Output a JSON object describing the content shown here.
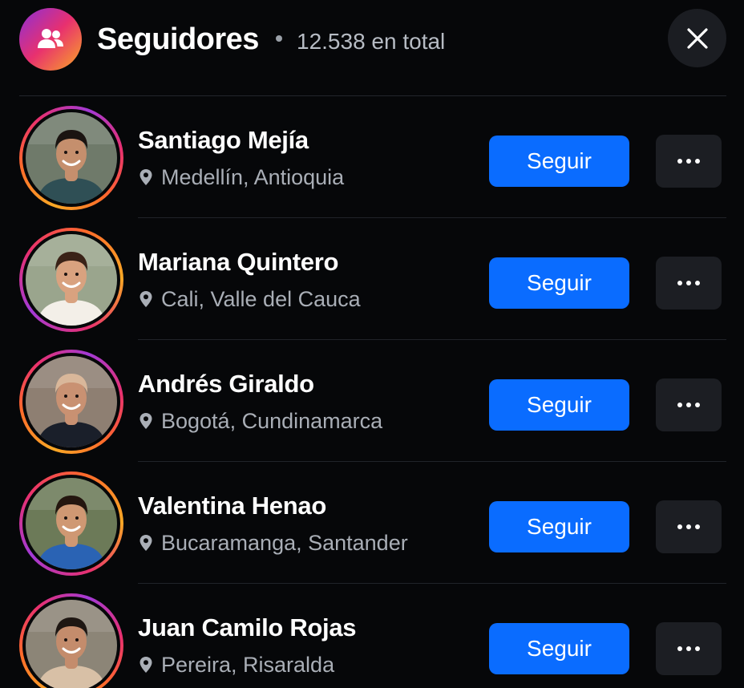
{
  "header": {
    "title": "Seguidores",
    "count_text": "12.538 en total",
    "icon": "users-icon",
    "close_icon": "close-icon"
  },
  "followers": [
    {
      "name": "Santiago Mejía",
      "location": "Medellín, Antioquia",
      "button": "Seguir",
      "avatar_bg": "#6f7a6a",
      "skin": "#c58f6d",
      "hair": "#1b1411",
      "shirt": "#2f4f55",
      "ring": "orange-pink"
    },
    {
      "name": "Mariana Quintero",
      "location": "Cali, Valle del Cauca",
      "button": "Seguir",
      "avatar_bg": "#9aa58d",
      "skin": "#d9a27f",
      "hair": "#3a2217",
      "shirt": "#f3efe8",
      "ring": "pink-purple"
    },
    {
      "name": "Andrés Giraldo",
      "location": "Bogotá, Cundinamarca",
      "button": "Seguir",
      "avatar_bg": "#8e7f72",
      "skin": "#c99172",
      "hair": "#d9b79a",
      "shirt": "#1a1f2a",
      "ring": "orange-pink"
    },
    {
      "name": "Valentina Henao",
      "location": "Bucaramanga, Santander",
      "button": "Seguir",
      "avatar_bg": "#6c7a58",
      "skin": "#cf9873",
      "hair": "#24160f",
      "shirt": "#2a63b4",
      "ring": "purple-pink"
    },
    {
      "name": "Juan Camilo Rojas",
      "location": "Pereira, Risaralda",
      "button": "Seguir",
      "avatar_bg": "#8c8577",
      "skin": "#c48c6c",
      "hair": "#1e1612",
      "shirt": "#d8c0a6",
      "ring": "orange-pink"
    }
  ],
  "colors": {
    "background": "#060709",
    "accent": "#0a6cff",
    "muted_text": "#a9aeb6"
  }
}
